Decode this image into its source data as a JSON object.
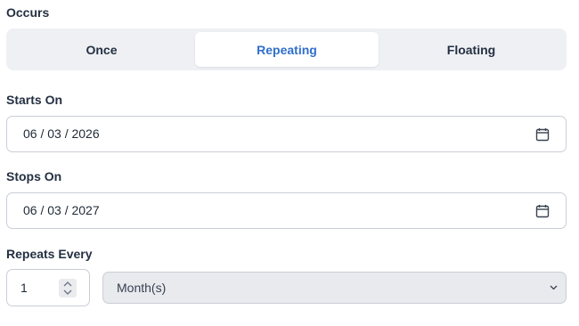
{
  "occurs": {
    "label": "Occurs",
    "options": [
      "Once",
      "Repeating",
      "Floating"
    ],
    "selected": "Repeating"
  },
  "starts_on": {
    "label": "Starts On",
    "value": "06 / 03 / 2026",
    "icon": "calendar-icon"
  },
  "stops_on": {
    "label": "Stops On",
    "value": "06 / 03 / 2027",
    "icon": "calendar-icon"
  },
  "repeats_every": {
    "label": "Repeats Every",
    "interval": "1",
    "unit": "Month(s)"
  },
  "colors": {
    "accent": "#2f6fcb",
    "segment_bg": "#eef0f4",
    "border": "#c9ced6"
  }
}
